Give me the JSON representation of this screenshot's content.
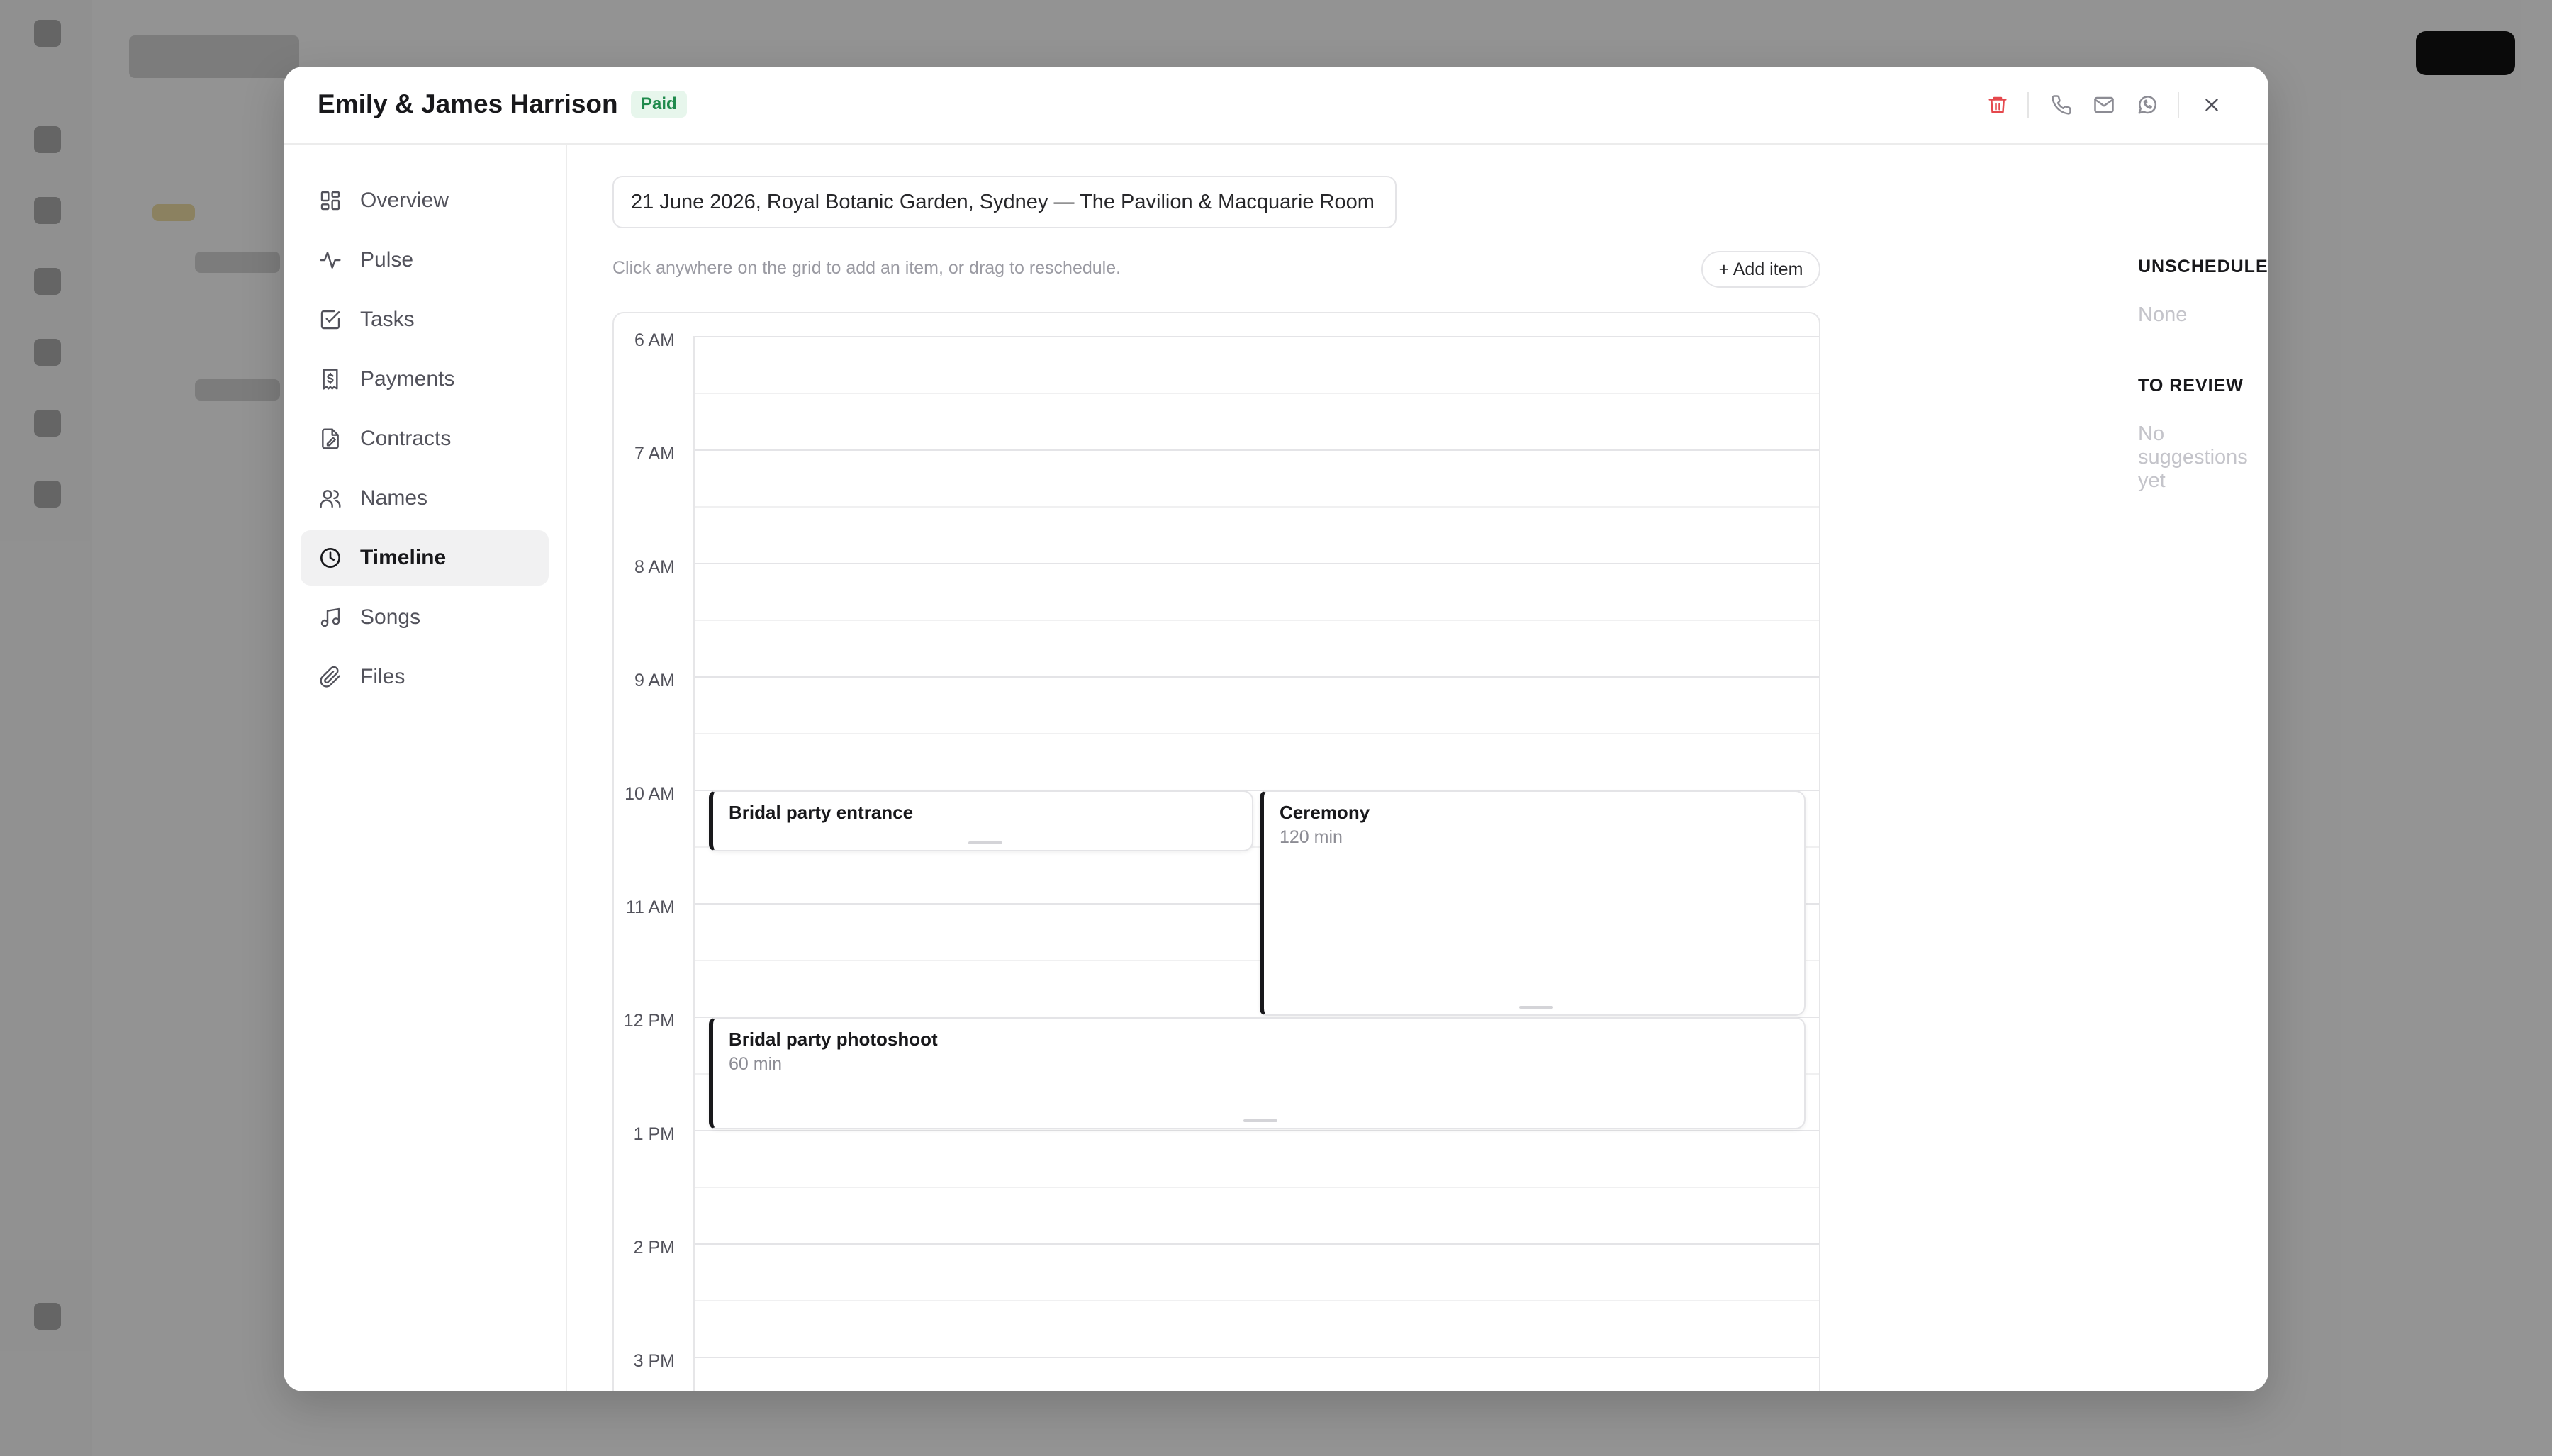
{
  "header": {
    "couple_name": "Emily & James Harrison",
    "status_badge": "Paid"
  },
  "sidebar": {
    "items": [
      {
        "label": "Overview",
        "icon": "overview-icon"
      },
      {
        "label": "Pulse",
        "icon": "pulse-icon"
      },
      {
        "label": "Tasks",
        "icon": "tasks-icon"
      },
      {
        "label": "Payments",
        "icon": "payments-icon"
      },
      {
        "label": "Contracts",
        "icon": "contracts-icon"
      },
      {
        "label": "Names",
        "icon": "names-icon"
      },
      {
        "label": "Timeline",
        "icon": "clock-icon",
        "active": true
      },
      {
        "label": "Songs",
        "icon": "music-icon"
      },
      {
        "label": "Files",
        "icon": "paperclip-icon"
      }
    ]
  },
  "main": {
    "event_details_value": "21 June 2026, Royal Botanic Garden, Sydney — The Pavilion & Macquarie Room",
    "hint": "Click anywhere on the grid to add an item, or drag to reschedule.",
    "add_item_label": "+ Add item",
    "hours": [
      "6 AM",
      "7 AM",
      "8 AM",
      "9 AM",
      "10 AM",
      "11 AM",
      "12 PM",
      "1 PM",
      "2 PM",
      "3 PM"
    ],
    "events": [
      {
        "title": "Bridal party entrance",
        "duration": ""
      },
      {
        "title": "Ceremony",
        "duration": "120 min"
      },
      {
        "title": "Bridal party photoshoot",
        "duration": "60 min"
      }
    ]
  },
  "right_panel": {
    "unscheduled_heading": "UNSCHEDULED",
    "unscheduled_empty": "None",
    "review_heading": "TO REVIEW",
    "review_empty": "No suggestions yet"
  },
  "colors": {
    "paid_badge_bg": "#e7f6ec",
    "paid_badge_text": "#1f8a4c",
    "delete_icon": "#e5484d",
    "event_accent": "#18181b"
  }
}
